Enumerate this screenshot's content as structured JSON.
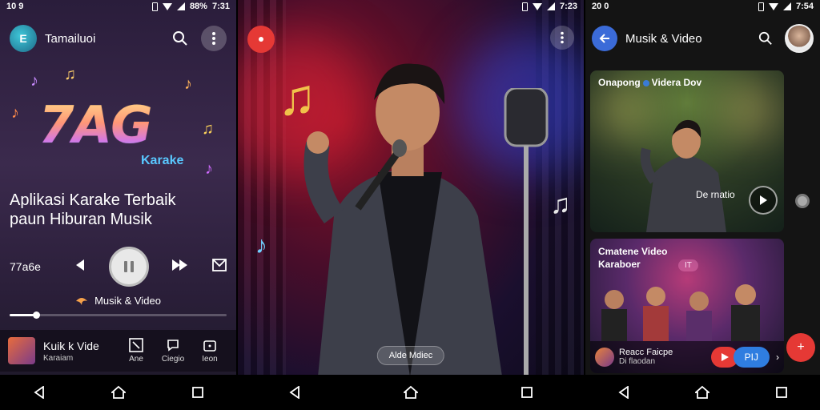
{
  "colors": {
    "accent_red": "#e53935",
    "accent_blue": "#3b6bd8",
    "panel1_bg": "#2a1d3b",
    "panel3_bg": "#141414"
  },
  "panel1": {
    "status": {
      "time": "10 9",
      "battery": "88%",
      "clock": "7:31"
    },
    "header": {
      "logo_letter": "E",
      "title": "Tamailuoi",
      "search_icon": "search-icon",
      "more_icon": "more-vert-icon"
    },
    "logo": {
      "main": "7AG",
      "sub": "Karake"
    },
    "headline": {
      "line1": "Aplikasi Karake Terbaik",
      "line2": "paun Hiburan Musik"
    },
    "controls": {
      "label": "77a6e"
    },
    "sub_link": "Musik & Video",
    "progress": 0.12,
    "bottom_bar": {
      "title": "Kuik k Vide",
      "subtitle": "Karaiam",
      "tabs": [
        {
          "label": "Ane"
        },
        {
          "label": "Ciegio"
        },
        {
          "label": "Ieon"
        }
      ]
    }
  },
  "panel2": {
    "status": {
      "time": "7:23"
    },
    "label": "Alde Mdiec"
  },
  "panel3": {
    "status": {
      "time": "20 0",
      "clock": "7:54"
    },
    "title": "Musik & Video",
    "card1": {
      "title_a": "Onapong",
      "title_b": "Videra Dov",
      "caption": "De rnatio"
    },
    "card2": {
      "title_line1": "Cmatene Video",
      "title_line2": "Karaboer",
      "foot_title": "Reacc Faicpe",
      "foot_sub": "Di flaodan",
      "pill": "PIJ",
      "glow_text": "IT"
    },
    "fab_label": "+"
  }
}
